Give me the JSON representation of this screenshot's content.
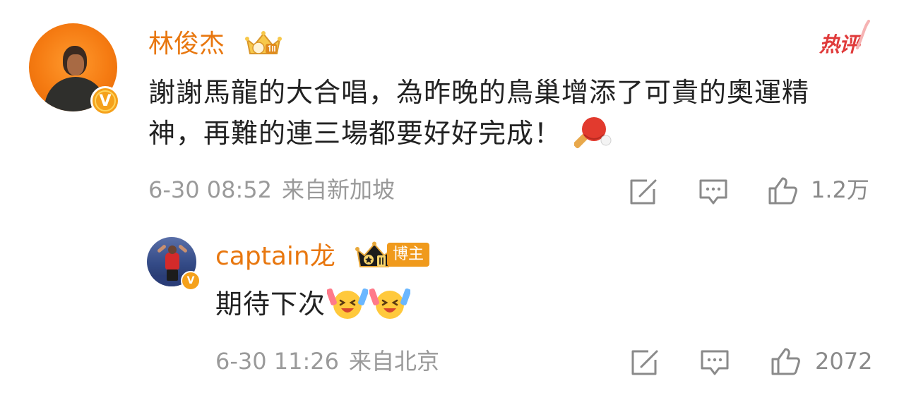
{
  "main_comment": {
    "username": "林俊杰",
    "hot_label": "热评",
    "text": "謝謝馬龍的大合唱，為昨晚的鳥巢增添了可貴的奧運精神，再難的連三場都要好好完成！",
    "time": "6-30 08:52",
    "location": "来自新加坡",
    "like_count": "1.2万",
    "verified_mark": "V",
    "emoji": "pingpong-icon"
  },
  "reply": {
    "username": "captain龙",
    "badge_label": "博主",
    "text": "期待下次",
    "time": "6-30 11:26",
    "location": "来自北京",
    "like_count": "2072",
    "verified_mark": "V",
    "emoji": "cheer-icon"
  },
  "colors": {
    "username": "#e8770f",
    "meta": "#9a9a9a",
    "text": "#222222",
    "hot": "#e03b3b",
    "verified": "#f5a11b"
  }
}
